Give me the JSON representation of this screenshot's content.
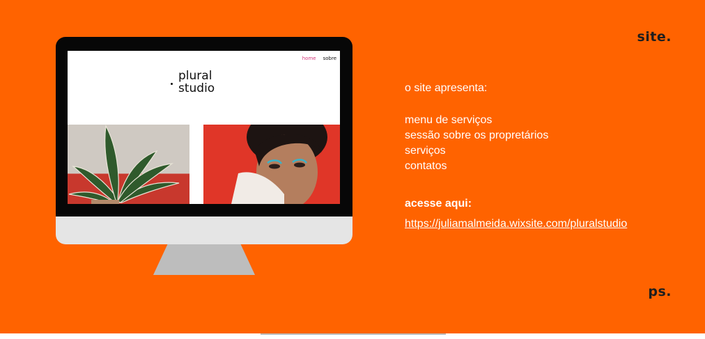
{
  "corner": {
    "top": "site.",
    "bottom": "ps."
  },
  "mockup": {
    "nav": {
      "home": "home",
      "sobre": "sobre"
    },
    "logo": {
      "line1": "plural",
      "line2": "studio"
    }
  },
  "info": {
    "heading": "o site apresenta:",
    "items": [
      "menu de serviços",
      "sessão sobre os propretários",
      "serviços",
      "contatos"
    ],
    "access_label": "acesse aqui:",
    "link": "https://juliamalmeida.wixsite.com/pluralstudio"
  },
  "colors": {
    "background": "#ff6300",
    "text": "#ffffff",
    "nav_active": "#d63b7d"
  }
}
